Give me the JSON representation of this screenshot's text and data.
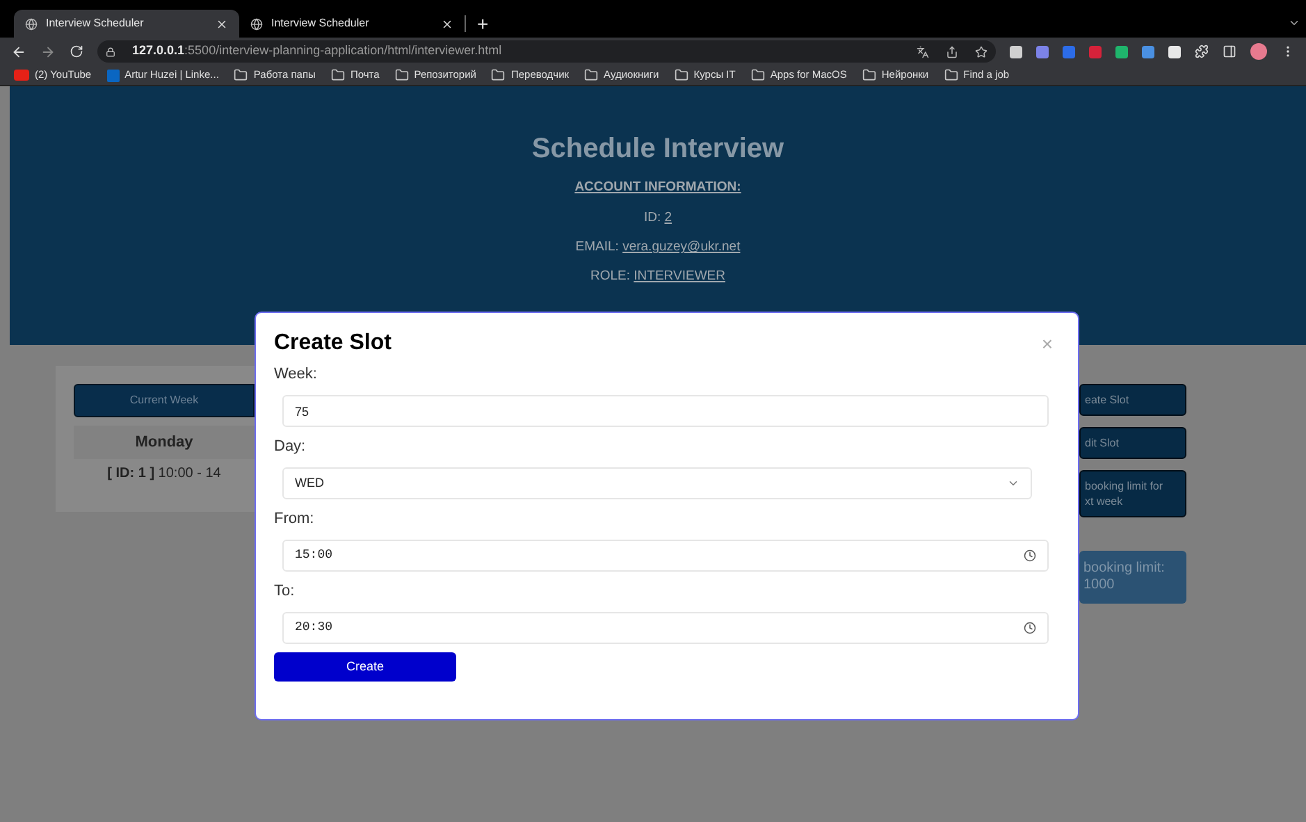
{
  "browser": {
    "tabs": [
      {
        "title": "Interview Scheduler",
        "selected": true
      },
      {
        "title": "Interview Scheduler",
        "selected": false
      }
    ],
    "new_tab": "+",
    "url": {
      "host": "127.0.0.1",
      "path": ":5500/interview-planning-application/html/interviewer.html"
    },
    "bookmarks": [
      {
        "kind": "youtube",
        "label": "(2) YouTube"
      },
      {
        "kind": "linkedin",
        "label": "Artur Huzei | Linke..."
      },
      {
        "kind": "folder",
        "label": "Работа папы"
      },
      {
        "kind": "folder",
        "label": "Почта"
      },
      {
        "kind": "folder",
        "label": "Репозиторий"
      },
      {
        "kind": "folder",
        "label": "Переводчик"
      },
      {
        "kind": "folder",
        "label": "Аудиокниги"
      },
      {
        "kind": "folder",
        "label": "Курсы IT"
      },
      {
        "kind": "folder",
        "label": "Apps for MacOS"
      },
      {
        "kind": "folder",
        "label": "Нейронки"
      },
      {
        "kind": "folder",
        "label": "Find a job"
      }
    ]
  },
  "header": {
    "title": "Schedule Interview",
    "account_heading": "ACCOUNT INFORMATION:",
    "fields": [
      {
        "label": "ID:",
        "value": "2"
      },
      {
        "label": "EMAIL:",
        "value": "vera.guzey@ukr.net"
      },
      {
        "label": "ROLE:",
        "value": "INTERVIEWER"
      }
    ]
  },
  "week_card": {
    "button": "Current Week",
    "column": "Monday",
    "cell": "**[ ID: 1 ]** 10:00 - 14"
  },
  "side_buttons": [
    {
      "kind": "button",
      "lines": [
        "eate Slot"
      ]
    },
    {
      "kind": "button",
      "lines": [
        "dit Slot"
      ]
    },
    {
      "kind": "button",
      "lines": [
        "booking limit for",
        "xt week"
      ]
    },
    {
      "kind": "info",
      "lines": [
        "booking limit:",
        "1000"
      ]
    }
  ],
  "modal": {
    "title": "Create Slot",
    "close": "×",
    "fields": [
      {
        "kind": "number",
        "label": "Week:",
        "value": "75"
      },
      {
        "kind": "select",
        "label": "Day:",
        "value": "WED"
      },
      {
        "kind": "time",
        "label": "From:",
        "value": "15:00"
      },
      {
        "kind": "time",
        "label": "To:",
        "value": "20:30"
      }
    ],
    "submit": "Create"
  }
}
